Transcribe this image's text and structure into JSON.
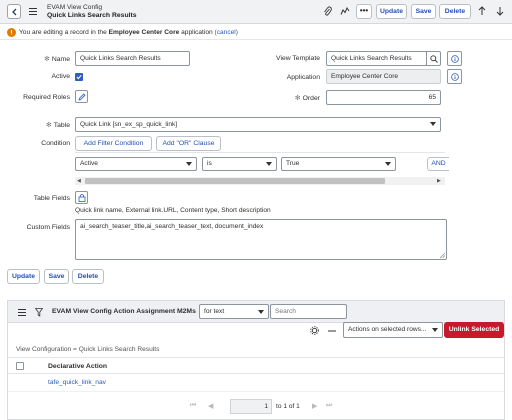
{
  "header": {
    "title": "EVAM View Config",
    "subtitle": "Quick Links Search Results",
    "update_label": "Update",
    "save_label": "Save",
    "delete_label": "Delete"
  },
  "info_bar": {
    "prefix": "You are editing a record in the ",
    "app_name": "Employee Center Core",
    "suffix": " application ",
    "cancel": "(cancel)"
  },
  "form": {
    "name_label": "Name",
    "name_value": "Quick Links Search Results",
    "active_label": "Active",
    "required_roles_label": "Required Roles",
    "view_template_label": "View Template",
    "view_template_value": "Quick Links Search Results",
    "application_label": "Application",
    "application_value": "Employee Center Core",
    "order_label": "Order",
    "order_value": "65",
    "table_label": "Table",
    "table_value": "Quick Link [sn_ex_sp_quick_link]",
    "condition_label": "Condition",
    "add_filter_label": "Add Filter Condition",
    "add_or_label": "Add \"OR\" Clause",
    "cond_field": "Active",
    "cond_operator": "is",
    "cond_value": "True",
    "and_label": "AND",
    "table_fields_label": "Table Fields",
    "table_fields_value": "Quick link name, External link.URL, Content type, Short description",
    "custom_fields_label": "Custom Fields",
    "custom_fields_value": "ai_search_teaser_title,ai_search_teaser_text, document_index"
  },
  "bottom_buttons": {
    "update": "Update",
    "save": "Save",
    "delete": "Delete"
  },
  "related_list": {
    "title": "EVAM View Config Action Assignment M2Ms",
    "filter_select": "for text",
    "search_placeholder": "Search",
    "actions_select": "Actions on selected rows...",
    "unlink_label": "Unlink Selected",
    "breadcrumb": "View Configuration = Quick Links Search Results",
    "column_header": "Declarative Action",
    "rows": [
      "tafe_quick_link_nav"
    ],
    "page_value": "1",
    "page_text": "to 1 of 1"
  },
  "colors": {
    "accent": "#2a58b5",
    "unlink": "#c8182c",
    "checkbox": "#2d5fbf"
  }
}
